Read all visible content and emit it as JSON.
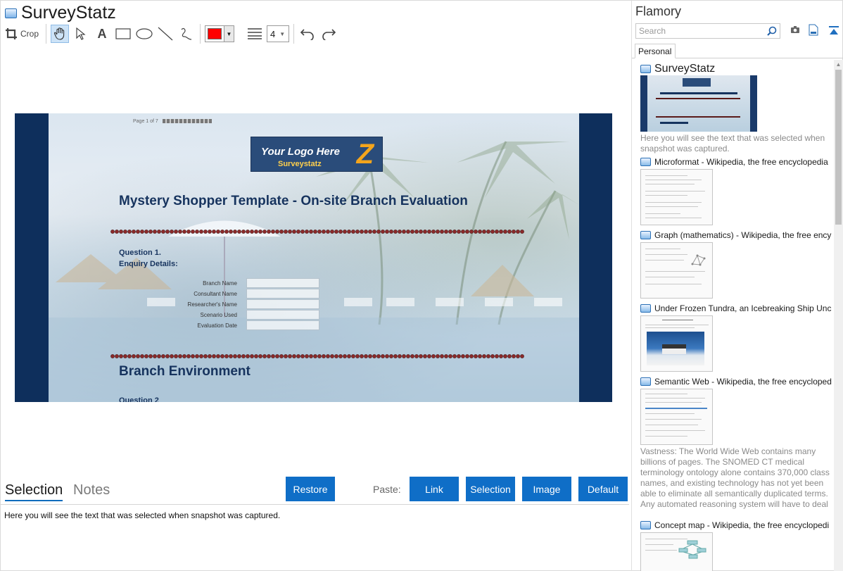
{
  "app": {
    "title": "SurveyStatz"
  },
  "toolbar": {
    "crop_label": "Crop",
    "stroke_width": "4",
    "color": "#ff0000",
    "tools": [
      "hand-icon",
      "pointer-icon",
      "text-icon",
      "rectangle-icon",
      "ellipse-icon",
      "line-icon",
      "freehand-icon",
      "color-picker",
      "stroke-width-icon",
      "undo-icon",
      "redo-icon"
    ]
  },
  "snapshot": {
    "page_indicator": "Page 1 of 7",
    "logo_line1": "Your Logo Here",
    "logo_line2": "Surveystatz",
    "logo_mark": "Z",
    "heading": "Mystery Shopper Template - On-site Branch Evaluation",
    "question1": "Question 1.",
    "question1_sub": "Enquiry Details:",
    "form_labels": [
      "Branch Name",
      "Consultant Name",
      "Researcher's Name",
      "Scenario Used",
      "Evaluation Date"
    ],
    "section2": "Branch Environment",
    "question2": "Question 2"
  },
  "bottom": {
    "tabs": [
      "Selection",
      "Notes"
    ],
    "restore_label": "Restore",
    "paste_label": "Paste:",
    "paste_buttons": [
      "Link",
      "Selection",
      "Image",
      "Default"
    ],
    "selection_text": "Here you will see the text that was selected when snapshot was captured.",
    "accent": "#0f6ec7"
  },
  "sidebar": {
    "title": "Flamory",
    "search_placeholder": "Search",
    "tab_label": "Personal",
    "entries": [
      {
        "title": "SurveyStatz",
        "desc": "Here you will see the text that was selected when snapshot was captured."
      },
      {
        "title": "Microformat - Wikipedia, the free encyclopedia",
        "desc": ""
      },
      {
        "title": "Graph (mathematics) - Wikipedia, the free ency",
        "desc": ""
      },
      {
        "title": "Under Frozen Tundra, an Icebreaking Ship Unco",
        "desc": ""
      },
      {
        "title": "Semantic Web - Wikipedia, the free encycloped",
        "desc": "Vastness: The World Wide Web contains many billions of pages. The SNOMED CT medical terminology ontology alone contains 370,000 class names, and existing technology has not yet been able to eliminate all semantically duplicated terms. Any automated reasoning system will have to deal with truly huge inputs."
      },
      {
        "title": "Concept map - Wikipedia, the free encyclopedi",
        "desc": ""
      }
    ]
  }
}
